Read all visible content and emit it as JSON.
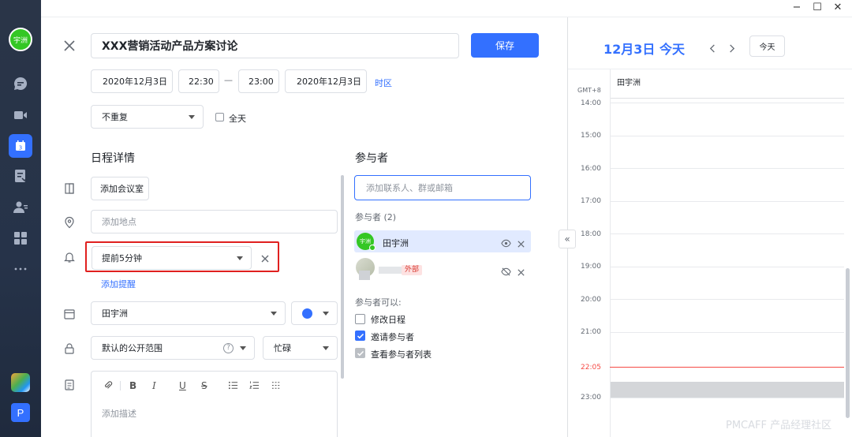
{
  "sidebar": {
    "avatar_text": "宇洲",
    "bottom_badge": "P"
  },
  "window": {
    "min": "−",
    "max": "☐",
    "close": "✕"
  },
  "editor": {
    "title": "XXX营销活动产品方案讨论",
    "save_label": "保存",
    "start_date": "2020年12月3日",
    "start_time": "22:30",
    "dash": "—",
    "end_time": "23:00",
    "end_date": "2020年12月3日",
    "timezone_link": "时区",
    "repeat": "不重复",
    "allday_label": "全天",
    "details_title": "日程详情",
    "add_room": "添加会议室",
    "location_placeholder": "添加地点",
    "reminder": "提前5分钟",
    "add_reminder": "添加提醒",
    "calendar_owner": "田宇洲",
    "calendar_color": "#3370ff",
    "visibility": "默认的公开范围",
    "busy": "忙碌",
    "desc_placeholder": "添加描述",
    "toolbar": {
      "bold": "B",
      "italic": "I",
      "underline": "U",
      "strike": "S"
    }
  },
  "participants": {
    "title": "参与者",
    "search_placeholder": "添加联系人、群或邮箱",
    "count_label": "参与者 (2)",
    "list": [
      {
        "avatar": "宇洲",
        "name": "田宇洲"
      },
      {
        "avatar": "",
        "name": "",
        "tag": "外部"
      }
    ],
    "permissions_title": "参与者可以:",
    "permissions": [
      {
        "label": "修改日程",
        "checked": false
      },
      {
        "label": "邀请参与者",
        "checked": true
      },
      {
        "label": "查看参与者列表",
        "checked": true
      }
    ]
  },
  "calendar": {
    "date_title": "12月3日 今天",
    "today_btn": "今天",
    "timezone": "GMT+8",
    "person": "田宇洲",
    "hours": [
      "14:00",
      "15:00",
      "16:00",
      "17:00",
      "18:00",
      "19:00",
      "20:00",
      "21:00",
      "22:05",
      "23:00"
    ],
    "collapse": "«",
    "now_color": "#f54a45"
  },
  "watermark": "PMCAFF 产品经理社区"
}
